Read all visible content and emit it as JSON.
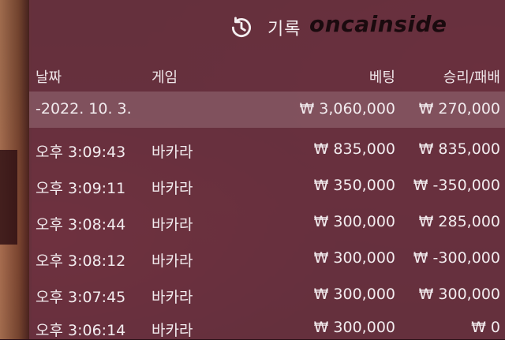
{
  "header": {
    "title": "기록",
    "watermark": "oncainside"
  },
  "columns": {
    "date": "날짜",
    "game": "게임",
    "bet": "베팅",
    "result": "승리/패배"
  },
  "summary": {
    "date": "-2022. 10. 3.",
    "game": "",
    "bet": "₩ 3,060,000",
    "result": "₩ 270,000"
  },
  "rows": [
    {
      "time": "오후 3:09:43",
      "game": "바카라",
      "bet": "₩ 835,000",
      "result": "₩ 835,000"
    },
    {
      "time": "오후 3:09:11",
      "game": "바카라",
      "bet": "₩ 350,000",
      "result": "₩ -350,000"
    },
    {
      "time": "오후 3:08:44",
      "game": "바카라",
      "bet": "₩ 300,000",
      "result": "₩ 285,000"
    },
    {
      "time": "오후 3:08:12",
      "game": "바카라",
      "bet": "₩ 300,000",
      "result": "₩ -300,000"
    },
    {
      "time": "오후 3:07:45",
      "game": "바카라",
      "bet": "₩ 300,000",
      "result": "₩ 300,000"
    },
    {
      "time": "오후 3:06:14",
      "game": "바카라",
      "bet": "₩ 300,000",
      "result": "₩ 0"
    }
  ]
}
